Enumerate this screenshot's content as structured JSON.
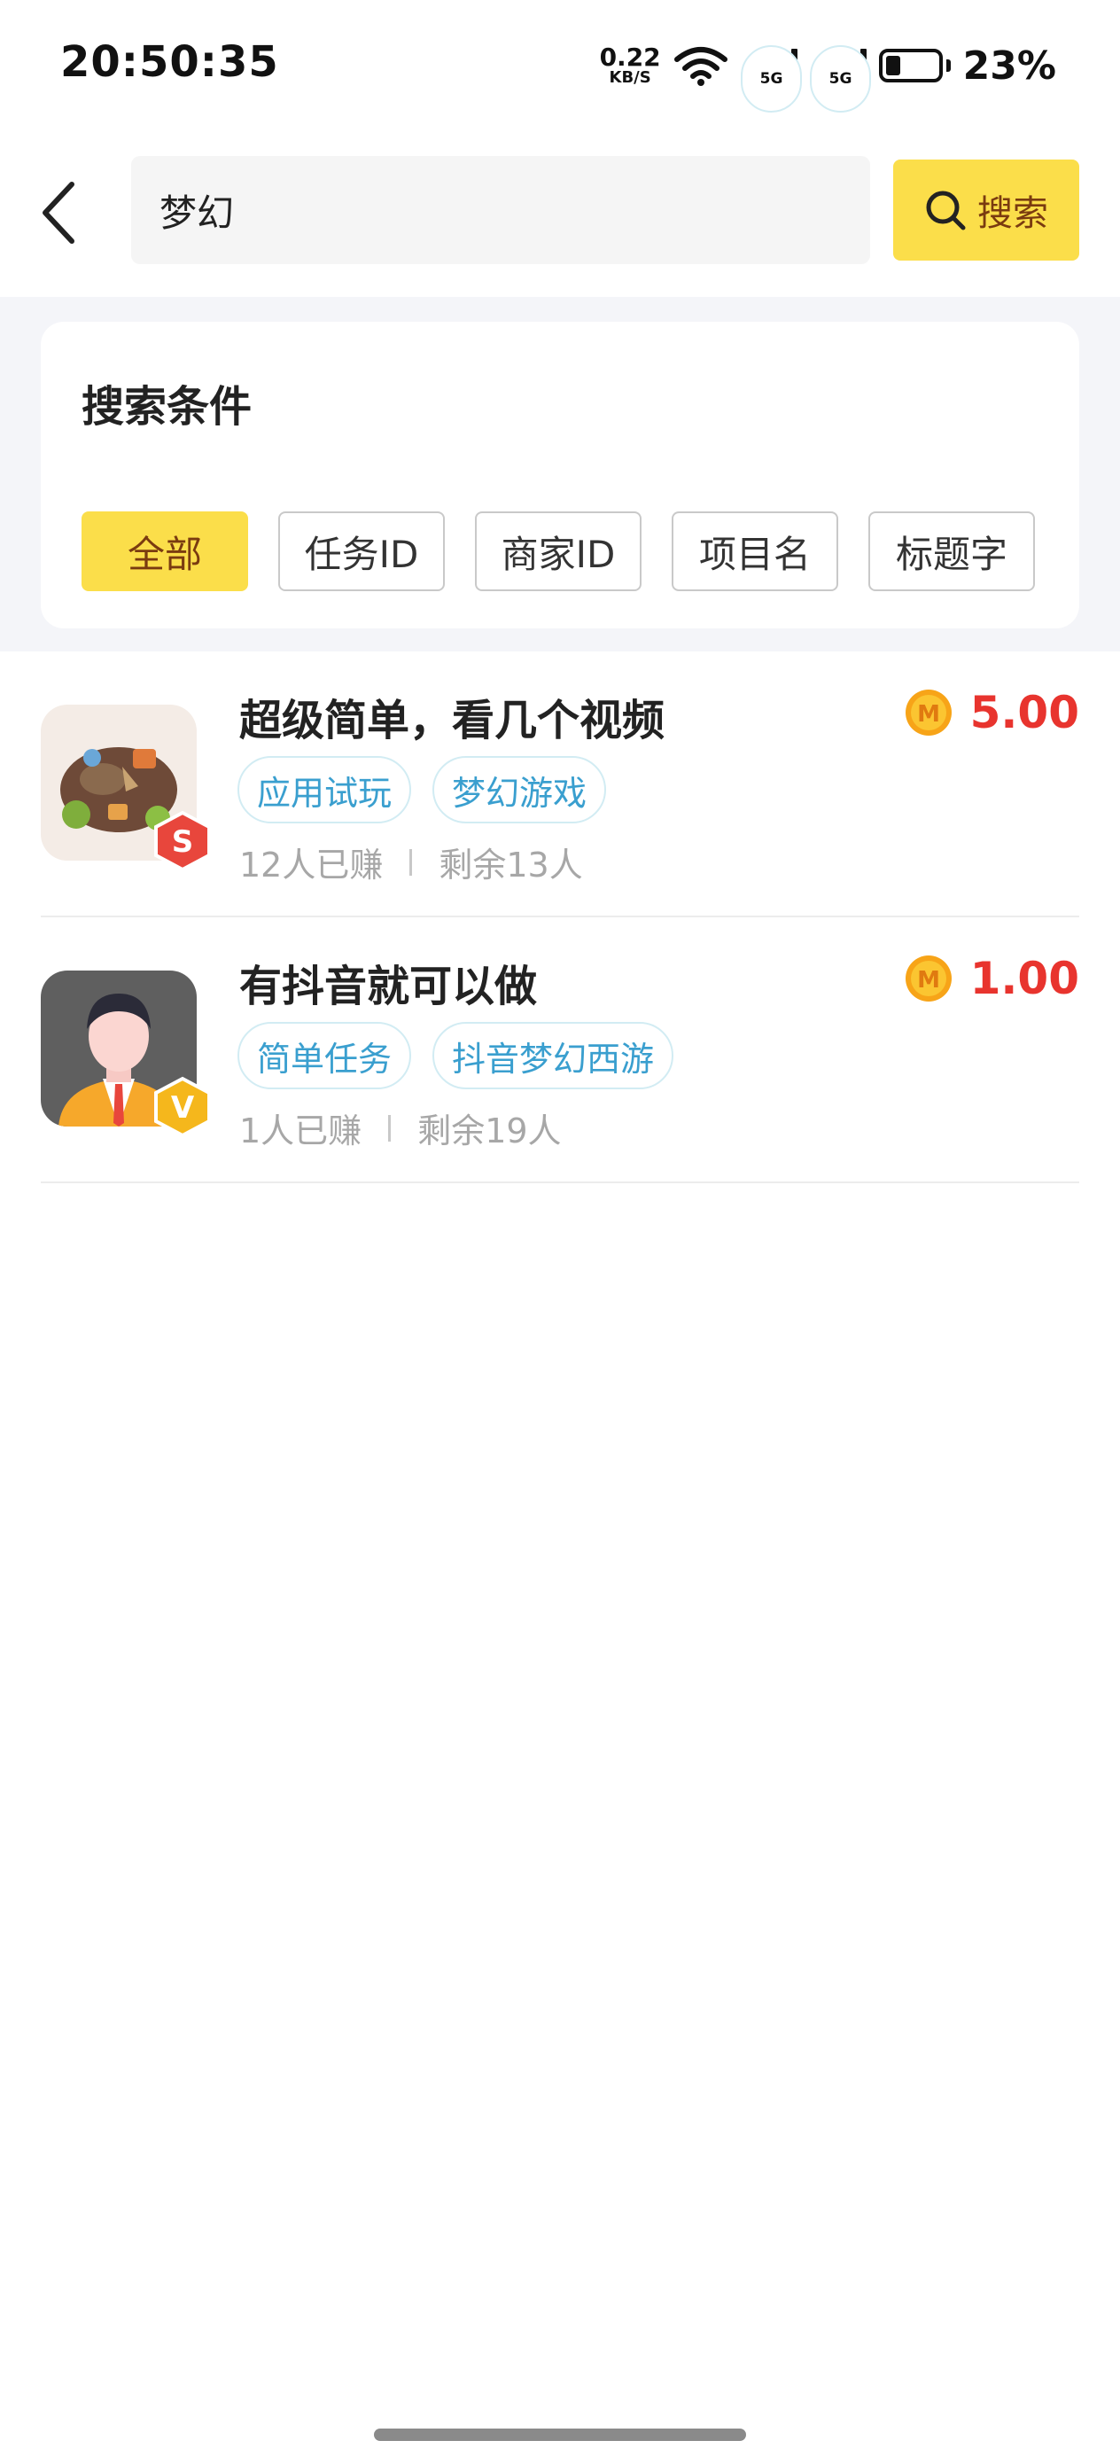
{
  "status_bar": {
    "time": "20:50:35",
    "net_speed_value": "0.22",
    "net_speed_unit": "KB/S",
    "sim1_tag": "5G",
    "sim2_tag": "5G",
    "battery": "23%",
    "battery_level": 0.23
  },
  "search": {
    "value": "梦幻",
    "button_label": "搜索"
  },
  "filter": {
    "title": "搜索条件",
    "options": [
      "全部",
      "任务ID",
      "商家ID",
      "项目名",
      "标题字"
    ],
    "active": "全部"
  },
  "tasks": [
    {
      "title": "超级简单，看几个视频",
      "reward": "5.00",
      "tags": [
        "应用试玩",
        "梦幻游戏"
      ],
      "earned": "12人已赚",
      "remaining": "剩余13人",
      "badge_letter": "S",
      "badge_color": "#e8463c"
    },
    {
      "title": "有抖音就可以做",
      "reward": "1.00",
      "tags": [
        "简单任务",
        "抖音梦幻西游"
      ],
      "earned": "1人已赚",
      "remaining": "剩余19人",
      "badge_letter": "V",
      "badge_color": "#f5b71c"
    }
  ],
  "coin_letter": "M",
  "colors": {
    "accent_yellow": "#fbde4a",
    "reward_red": "#e8342e",
    "tag_blue": "#3a9fcf"
  }
}
